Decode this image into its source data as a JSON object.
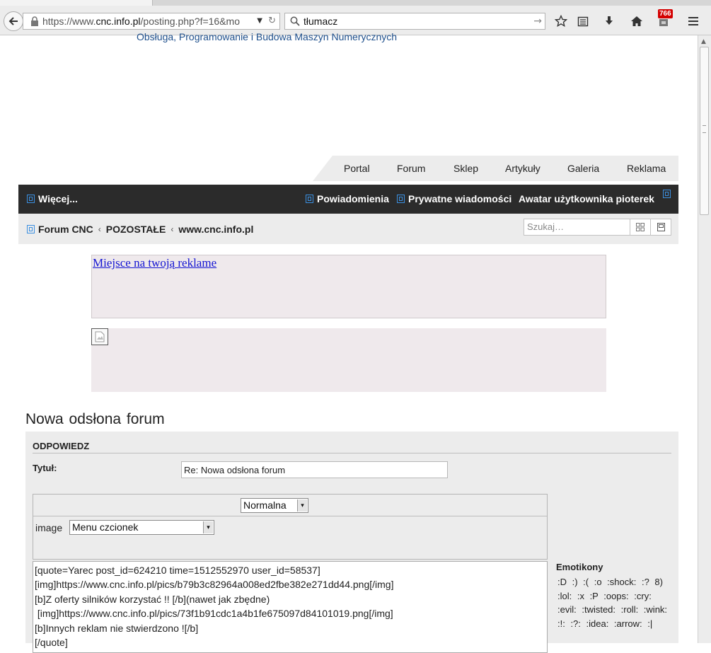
{
  "browser": {
    "url_prefix": "https://www.",
    "url_domain": "cnc.info.pl",
    "url_path": "/posting.php?f=16&mo",
    "search_value": "tłumacz",
    "notification_count": "766"
  },
  "site": {
    "tagline": "Obsługa, Programowanie i Budowa Maszyn Numerycznych",
    "topnav": [
      "Portal",
      "Forum",
      "Sklep",
      "Artykuły",
      "Galeria",
      "Reklama"
    ],
    "darkbar": {
      "more": "Więcej...",
      "notifications": "Powiadomienia",
      "messages": "Prywatne wiadomości",
      "avatar": "Awatar użytkownika pioterek"
    },
    "breadcrumb": [
      "Forum CNC",
      "POZOSTAŁE",
      "www.cnc.info.pl"
    ],
    "search_placeholder": "Szukaj…",
    "ad_link": "Miejsce na twoją reklame"
  },
  "posting": {
    "page_title": "Nowa odsłona forum",
    "section": "ODPOWIEDZ",
    "subject_label": "Tytuł:",
    "subject_value": "Re: Nowa odsłona forum",
    "font_size": "Normalna",
    "image_label": "image",
    "font_menu": "Menu czcionek",
    "message_lines": [
      "[quote=Yarec post_id=624210 time=1512552970 user_id=58537]",
      "[img]https://www.cnc.info.pl/pics/b79b3c82964a008ed2fbe382e271dd44.png[/img]",
      "[b]Z oferty silników korzystać !! [/b](nawet jak zbędne)",
      " [img]https://www.cnc.info.pl/pics/73f1b91cdc1a4b1fe675097d84101019.png[/img]",
      "[b]Innych reklam nie stwierdzono ![/b]",
      "[/quote]"
    ],
    "emoticons_title": "Emotikony",
    "emoticons": ":D  :)  :(  :o  :shock:  :?  8)  :lol:  :x  :P  :oops:  :cry:  :evil:  :twisted:  :roll:  :wink:  :!:  :?:  :idea:  :arrow:  :|"
  }
}
